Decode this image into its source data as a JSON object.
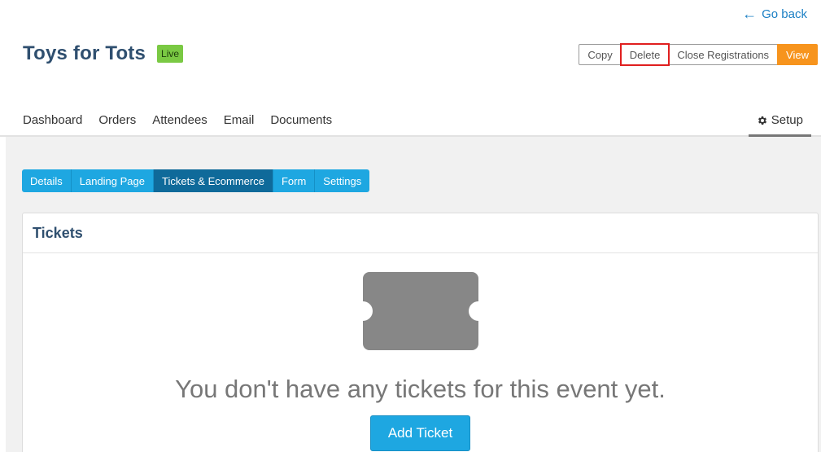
{
  "header": {
    "go_back": "Go back",
    "event_title": "Toys for Tots",
    "status_badge": "Live"
  },
  "actions": {
    "copy": "Copy",
    "delete": "Delete",
    "close_registrations": "Close Registrations",
    "view": "View"
  },
  "main_nav": {
    "items": [
      "Dashboard",
      "Orders",
      "Attendees",
      "Email",
      "Documents"
    ],
    "setup": "Setup",
    "active": "Setup"
  },
  "sub_tabs": {
    "items": [
      "Details",
      "Landing Page",
      "Tickets & Ecommerce",
      "Form",
      "Settings"
    ],
    "active": "Tickets & Ecommerce"
  },
  "tickets_panel": {
    "title": "Tickets",
    "empty_message": "You don't have any tickets for this event yet.",
    "add_button": "Add Ticket",
    "icon": "ticket-icon"
  },
  "colors": {
    "accent_blue": "#1ea7e1",
    "active_tab": "#0f6a9a",
    "view_orange": "#f7941d",
    "live_green": "#7ac943",
    "title_navy": "#2f4f6f",
    "highlight_red": "#e01f1f"
  }
}
